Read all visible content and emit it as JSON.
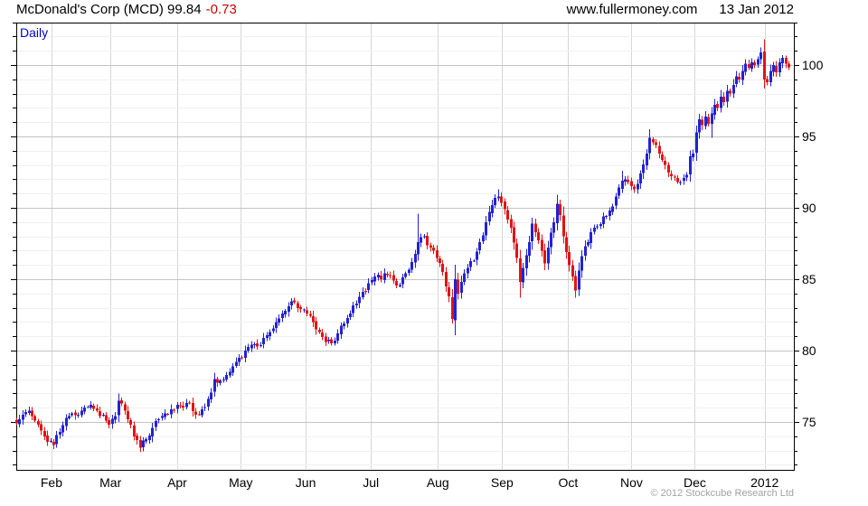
{
  "header": {
    "title": "McDonald's Corp (MCD) 99.84",
    "change": "-0.73",
    "site": "www.fullermoney.com",
    "date": "13 Jan 2012"
  },
  "chart": {
    "frequency_label": "Daily",
    "copyright": "© 2012 Stockcube Research Ltd"
  },
  "chart_data": {
    "type": "candlestick",
    "title": "McDonald's Corp (MCD) daily candlestick chart, one year to 13 Jan 2012",
    "last_price": 99.84,
    "change": -0.73,
    "ylim": [
      71.6,
      103.0
    ],
    "y_major_ticks": [
      75,
      80,
      85,
      90,
      95,
      100
    ],
    "y_minor_step": 1,
    "x_range_days": [
      0,
      250
    ],
    "legend_position": "none",
    "grid": "on",
    "months": [
      {
        "label": "Feb",
        "day": 11.4
      },
      {
        "label": "Mar",
        "day": 30.5
      },
      {
        "label": "Apr",
        "day": 52.1
      },
      {
        "label": "May",
        "day": 72.7
      },
      {
        "label": "Jun",
        "day": 93.7
      },
      {
        "label": "Jul",
        "day": 114.8
      },
      {
        "label": "Aug",
        "day": 136.5
      },
      {
        "label": "Sep",
        "day": 157.3
      },
      {
        "label": "Oct",
        "day": 178.7
      },
      {
        "label": "Nov",
        "day": 199.2
      },
      {
        "label": "Dec",
        "day": 219.7
      },
      {
        "label": "2012",
        "day": 242.3
      }
    ],
    "colors": {
      "up": "#2222d4",
      "down": "#e21313"
    },
    "anchors": [
      [
        0,
        74.9
      ],
      [
        1,
        75.2
      ],
      [
        2,
        75.5
      ],
      [
        3,
        75.7
      ],
      [
        4,
        75.8
      ],
      [
        5,
        75.4
      ],
      [
        6,
        75.1
      ],
      [
        7,
        74.8
      ],
      [
        8,
        74.4
      ],
      [
        9,
        74.0
      ],
      [
        10,
        73.6
      ],
      [
        12,
        73.4
      ],
      [
        14,
        74.3
      ],
      [
        16,
        75.3
      ],
      [
        18,
        75.6
      ],
      [
        20,
        75.5
      ],
      [
        22,
        76.0
      ],
      [
        24,
        76.2
      ],
      [
        26,
        75.8
      ],
      [
        28,
        75.5
      ],
      [
        30,
        74.8
      ],
      [
        32,
        75.4
      ],
      [
        33,
        76.5
      ],
      [
        34,
        76.3
      ],
      [
        36,
        75.2
      ],
      [
        38,
        74.0
      ],
      [
        40,
        73.2
      ],
      [
        42,
        73.8
      ],
      [
        44,
        74.6
      ],
      [
        46,
        75.2
      ],
      [
        48,
        75.6
      ],
      [
        50,
        75.9
      ],
      [
        52,
        76.2
      ],
      [
        54,
        76.0
      ],
      [
        56,
        76.3
      ],
      [
        58,
        75.5
      ],
      [
        60,
        75.9
      ],
      [
        62,
        76.6
      ],
      [
        64,
        78.0
      ],
      [
        66,
        77.9
      ],
      [
        68,
        78.3
      ],
      [
        70,
        78.9
      ],
      [
        72,
        79.5
      ],
      [
        74,
        80.0
      ],
      [
        76,
        80.4
      ],
      [
        78,
        80.3
      ],
      [
        80,
        80.9
      ],
      [
        82,
        81.3
      ],
      [
        84,
        82.0
      ],
      [
        86,
        82.6
      ],
      [
        88,
        83.1
      ],
      [
        90,
        83.4
      ],
      [
        92,
        82.9
      ],
      [
        94,
        82.6
      ],
      [
        96,
        82.0
      ],
      [
        98,
        81.3
      ],
      [
        100,
        80.6
      ],
      [
        102,
        80.5
      ],
      [
        104,
        81.2
      ],
      [
        106,
        81.9
      ],
      [
        108,
        82.6
      ],
      [
        110,
        83.3
      ],
      [
        112,
        84.1
      ],
      [
        114,
        84.7
      ],
      [
        116,
        85.2
      ],
      [
        118,
        85.0
      ],
      [
        120,
        85.3
      ],
      [
        122,
        84.9
      ],
      [
        124,
        84.6
      ],
      [
        126,
        85.4
      ],
      [
        128,
        86.2
      ],
      [
        130,
        87.6
      ],
      [
        132,
        88.0
      ],
      [
        134,
        87.2
      ],
      [
        136,
        86.5
      ],
      [
        138,
        85.5
      ],
      [
        140,
        83.8
      ],
      [
        141,
        82.2
      ],
      [
        142,
        85.0
      ],
      [
        143,
        84.0
      ],
      [
        144,
        84.8
      ],
      [
        146,
        85.8
      ],
      [
        148,
        86.3
      ],
      [
        150,
        87.6
      ],
      [
        152,
        89.0
      ],
      [
        154,
        90.2
      ],
      [
        156,
        90.8
      ],
      [
        158,
        89.9
      ],
      [
        160,
        88.6
      ],
      [
        162,
        86.5
      ],
      [
        163,
        84.8
      ],
      [
        164,
        85.8
      ],
      [
        166,
        87.6
      ],
      [
        167,
        88.9
      ],
      [
        168,
        88.3
      ],
      [
        170,
        87.0
      ],
      [
        171,
        86.1
      ],
      [
        172,
        87.2
      ],
      [
        174,
        89.0
      ],
      [
        175,
        90.3
      ],
      [
        176,
        89.5
      ],
      [
        177,
        88.0
      ],
      [
        178,
        86.9
      ],
      [
        180,
        85.2
      ],
      [
        181,
        84.2
      ],
      [
        182,
        85.6
      ],
      [
        184,
        87.3
      ],
      [
        186,
        88.3
      ],
      [
        188,
        88.7
      ],
      [
        190,
        89.4
      ],
      [
        192,
        89.8
      ],
      [
        194,
        90.8
      ],
      [
        196,
        91.9
      ],
      [
        198,
        91.8
      ],
      [
        200,
        91.3
      ],
      [
        202,
        92.4
      ],
      [
        204,
        93.8
      ],
      [
        205,
        94.9
      ],
      [
        206,
        94.6
      ],
      [
        208,
        93.8
      ],
      [
        210,
        93.0
      ],
      [
        212,
        92.2
      ],
      [
        214,
        91.8
      ],
      [
        216,
        92.1
      ],
      [
        217,
        92.3
      ],
      [
        218,
        93.6
      ],
      [
        219,
        93.8
      ],
      [
        220,
        95.3
      ],
      [
        221,
        96.2
      ],
      [
        222,
        95.8
      ],
      [
        223,
        96.4
      ],
      [
        224,
        95.9
      ],
      [
        225,
        96.6
      ],
      [
        226,
        97.2
      ],
      [
        227,
        97.0
      ],
      [
        228,
        97.8
      ],
      [
        229,
        97.4
      ],
      [
        230,
        98.2
      ],
      [
        231,
        98.0
      ],
      [
        232,
        98.6
      ],
      [
        233,
        99.2
      ],
      [
        234,
        99.0
      ],
      [
        235,
        99.6
      ],
      [
        236,
        100.1
      ],
      [
        237,
        99.8
      ],
      [
        238,
        100.2
      ],
      [
        239,
        100.0
      ],
      [
        240,
        100.4
      ],
      [
        241,
        100.9
      ],
      [
        242,
        99.0
      ],
      [
        243,
        98.8
      ],
      [
        244,
        99.6
      ],
      [
        245,
        100.0
      ],
      [
        246,
        99.5
      ],
      [
        247,
        100.2
      ],
      [
        248,
        100.5
      ],
      [
        249,
        100.1
      ],
      [
        250,
        99.84
      ]
    ],
    "wick_overrides": [
      [
        12,
        "l",
        73.1
      ],
      [
        40,
        "l",
        72.9
      ],
      [
        90,
        "h",
        83.7
      ],
      [
        130,
        "h",
        89.6
      ],
      [
        141,
        "l",
        81.9
      ],
      [
        156,
        "h",
        91.3
      ],
      [
        163,
        "l",
        83.7
      ],
      [
        181,
        "l",
        83.7
      ],
      [
        196,
        "h",
        92.6
      ],
      [
        205,
        "h",
        95.5
      ],
      [
        225,
        "l",
        94.9
      ],
      [
        242,
        "h",
        101.8
      ]
    ]
  }
}
